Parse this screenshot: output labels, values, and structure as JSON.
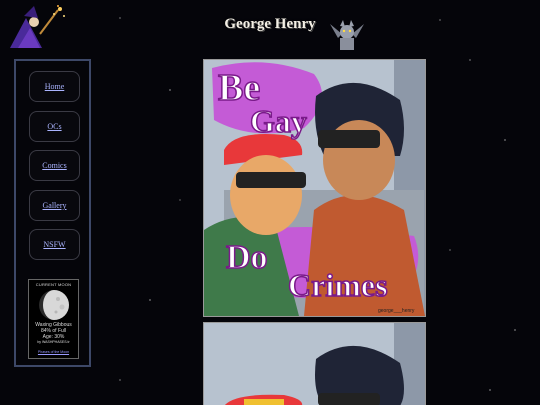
{
  "site": {
    "title": "George Henry"
  },
  "nav": {
    "items": [
      {
        "label": "Home"
      },
      {
        "label": "OCs"
      },
      {
        "label": "Comics"
      },
      {
        "label": "Gallery"
      },
      {
        "label": "NSFW"
      }
    ]
  },
  "moon": {
    "header": "CURRENT MOON",
    "phase": "Waxing Gibbous",
    "percent": "84% of Full",
    "age": "Age: 30%",
    "credit": "by WASHPHASES.tr",
    "link": "Phases of the Moon"
  },
  "gallery": {
    "images": [
      {
        "lines": [
          "Be",
          "Gay",
          "Do",
          "Crimes"
        ],
        "signature": "george___henry"
      },
      {
        "lines": [],
        "signature": ""
      }
    ]
  },
  "colors": {
    "background": "#05050a",
    "sidebar_border": "#3d4868",
    "link": "#aab4ff",
    "art_purple": "#c45bd6",
    "art_bg": "#b7c2cf"
  }
}
